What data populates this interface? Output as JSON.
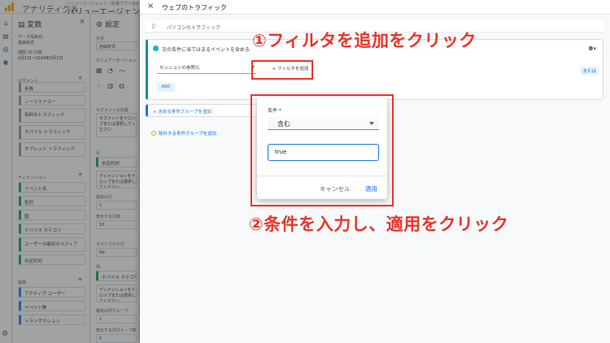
{
  "app": {
    "brand": "アナリティクス",
    "crumb": "バリューエージェント（各種アプリ含む）",
    "property": "バリューエージェント(各"
  },
  "variables_panel": {
    "title": "変数",
    "exploration_name_label": "データ探索名:",
    "exploration_name": "自由形式",
    "date_label": "期間 28 日間",
    "date_value": "2月1日〜2024年3月1日",
    "segments_heading": "セグメント",
    "segments": [
      " 全員",
      "ノーリファラー",
      "有料のトラフィック",
      "モバイル トラフィック",
      "タブレット トラフィック"
    ],
    "dimensions_heading": "ディメンション",
    "dimensions": [
      "イベント名",
      "性別",
      "国",
      "デバイス カテゴリ",
      "ユーザーの最初のメディア",
      "市区町村"
    ],
    "metrics_heading": "指標",
    "metrics": [
      "アクティブ ユーザー",
      "イベント数",
      "トランザクション"
    ]
  },
  "settings_panel": {
    "title": "設定",
    "technique_label": "手法",
    "technique": "自由形式",
    "visualization_label": "ビジュアリゼーション",
    "segment_compare_label": "セグメントの比較",
    "segment_drop_hint": "セグメントをドロップまたは選択してください",
    "rows_label": "行",
    "row_item": "市区町村",
    "dim_drop_hint": "ディメンションをドロップまたは選択してください",
    "start_row_label": "最初の行",
    "start_row": "1",
    "show_rows_label": "表示する行数",
    "show_rows": "10",
    "nested_label": "ネストされた行",
    "nested": "No",
    "cols_label": "列",
    "col_item": "デバイス カテゴリ",
    "col_group_label": "最初の列グループ",
    "col_group": "1",
    "col_count_label": "表示する列グループ数",
    "col_count": "5"
  },
  "sheet": {
    "title": "ウェブのトラフィック",
    "name_field": "パソコンのトラフィック",
    "condition_header": "次の条件に当てはまるイベントを含める:",
    "dimension_select": "セッションの参照元",
    "add_filter": "フィルタを追加",
    "or_label": "または",
    "and_button": "AND",
    "include_group": "含める条件グループを追加",
    "exclude_group": "除外する条件グループを追加"
  },
  "popup": {
    "condition_label": "条件 *",
    "condition_value": "含む",
    "input_value": "true",
    "cancel": "キャンセル",
    "apply": "適用"
  },
  "annotations": {
    "step1": "①フィルタを追加をクリック",
    "step2": "②条件を入力し、適用をクリック",
    "color": "#e8352c"
  }
}
